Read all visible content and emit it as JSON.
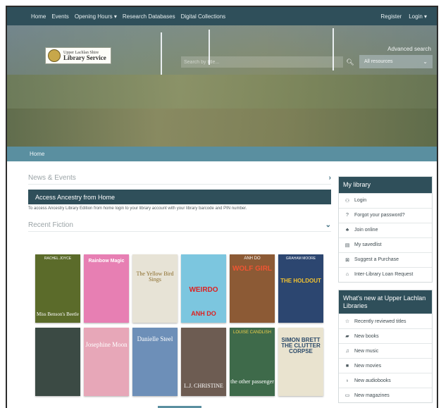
{
  "topnav": {
    "left": [
      "Home",
      "Events",
      "Opening Hours ▾",
      "Research Databases",
      "Digital Collections"
    ],
    "right": [
      "Register",
      "Login ▾"
    ]
  },
  "hero": {
    "logo_line1": "Upper Lachlan Shire",
    "logo_line2": "Library Service",
    "advanced_search": "Advanced search",
    "search_placeholder": "Search by title...",
    "resource_select": "All resources"
  },
  "breadcrumb": "Home",
  "main": {
    "news_heading": "News & Events",
    "banner_title": "Access Ancestry from Home",
    "banner_note": "To access Ancestry Library Edition from home login to your library account with your library barcode and PIN number.",
    "fiction_heading": "Recent Fiction"
  },
  "books": [
    {
      "title": "Miss Benson's Beetle",
      "author": "RACHEL JOYCE",
      "color": "#5b6b2a"
    },
    {
      "title": "Rainbow Magic",
      "author": "",
      "color": "#e77fb3"
    },
    {
      "title": "The Yellow Bird Sings",
      "author": "",
      "color": "#e7e3d6"
    },
    {
      "title": "WEIRDO",
      "author": "ANH DO",
      "color": "#7cc6df"
    },
    {
      "title": "WOLF GIRL",
      "author": "ANH DO",
      "color": "#8c5a35"
    },
    {
      "title": "THE HOLDOUT",
      "author": "GRAHAM MOORE",
      "color": "#2c4670"
    },
    {
      "title": "",
      "author": "",
      "color": "#3b4a44"
    },
    {
      "title": "Josephine Moon",
      "author": "",
      "color": "#e7a7b8"
    },
    {
      "title": "Danielle Steel",
      "author": "",
      "color": "#6d8fb8"
    },
    {
      "title": "L.J. CHRISTINE",
      "author": "",
      "color": "#6d5c52"
    },
    {
      "title": "the other passenger",
      "author": "LOUISE CANDLISH",
      "color": "#3e6a4a"
    },
    {
      "title": "SIMON BRETT THE CLUTTER CORPSE",
      "author": "",
      "color": "#e9e3cf"
    }
  ],
  "my_library": {
    "title": "My library",
    "items": [
      {
        "icon": "user-icon",
        "glyph": "⚇",
        "label": "Login"
      },
      {
        "icon": "question-icon",
        "glyph": "?",
        "label": "Forgot your password?"
      },
      {
        "icon": "add-user-icon",
        "glyph": "♣",
        "label": "Join online"
      },
      {
        "icon": "list-icon",
        "glyph": "▤",
        "label": "My savedlist"
      },
      {
        "icon": "suggest-icon",
        "glyph": "⊠",
        "label": "Suggest a Purchase"
      },
      {
        "icon": "library-icon",
        "glyph": "⌂",
        "label": "Inter-Library Loan Request"
      }
    ]
  },
  "whats_new": {
    "title": "What's new at Upper Lachlan Libraries",
    "items": [
      {
        "icon": "star-icon",
        "glyph": "☆",
        "label": "Recently reviewed titles"
      },
      {
        "icon": "book-icon",
        "glyph": "▰",
        "label": "New books"
      },
      {
        "icon": "music-icon",
        "glyph": "♫",
        "label": "New music"
      },
      {
        "icon": "video-icon",
        "glyph": "■",
        "label": "New movies"
      },
      {
        "icon": "headphones-icon",
        "glyph": "♁",
        "label": "New audiobooks"
      },
      {
        "icon": "magazine-icon",
        "glyph": "▭",
        "label": "New magazines"
      }
    ]
  }
}
